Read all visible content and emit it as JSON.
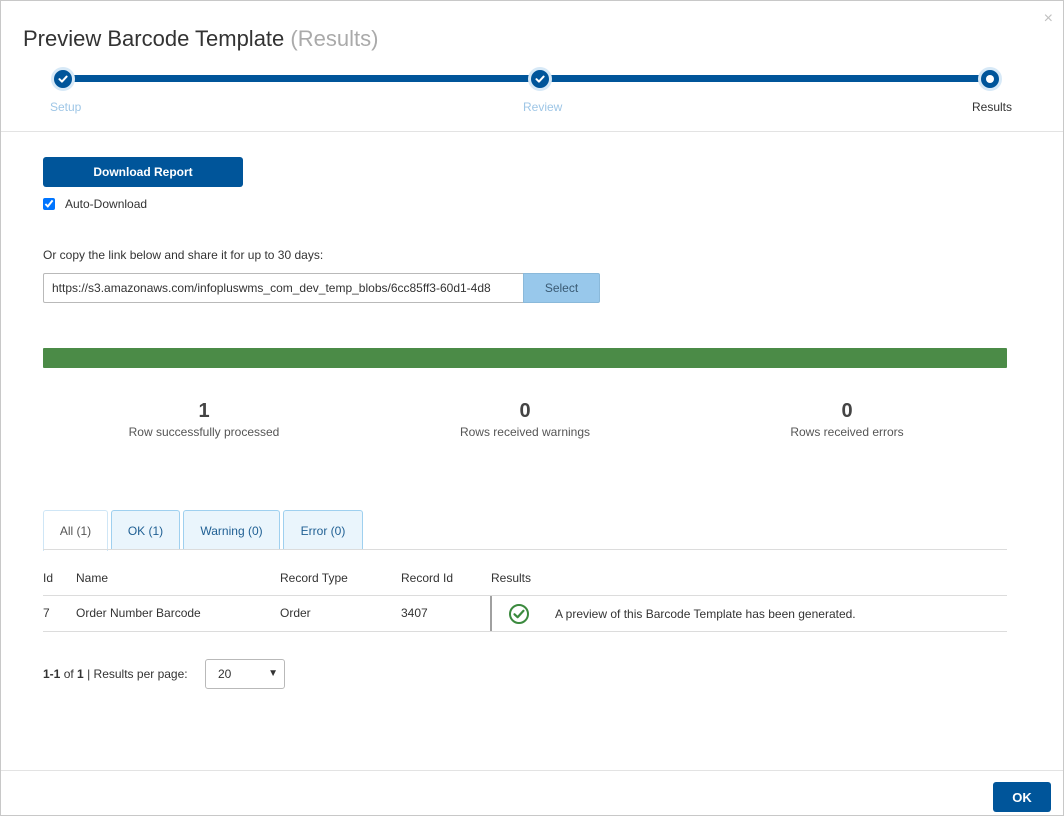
{
  "dialog": {
    "title": "Preview Barcode Template",
    "title_suffix": "(Results)",
    "close_symbol": "×"
  },
  "stepper": {
    "steps": [
      {
        "label": "Setup",
        "state": "complete"
      },
      {
        "label": "Review",
        "state": "complete"
      },
      {
        "label": "Results",
        "state": "current"
      }
    ]
  },
  "actions": {
    "download_label": "Download Report",
    "auto_download_label": "Auto-Download",
    "auto_download_checked": true
  },
  "share": {
    "instruction": "Or copy the link below and share it for up to 30 days:",
    "link_value": "https://s3.amazonaws.com/infopluswms_com_dev_temp_blobs/6cc85ff3-60d1-4d8",
    "select_label": "Select"
  },
  "progress": {
    "percent": 100,
    "color": "#4b8b47"
  },
  "stats": [
    {
      "value": "1",
      "label": "Row successfully processed"
    },
    {
      "value": "0",
      "label": "Rows received warnings"
    },
    {
      "value": "0",
      "label": "Rows received errors"
    }
  ],
  "tabs": [
    {
      "label": "All (1)",
      "active": true
    },
    {
      "label": "OK (1)",
      "active": false
    },
    {
      "label": "Warning (0)",
      "active": false
    },
    {
      "label": "Error (0)",
      "active": false
    }
  ],
  "table": {
    "columns": [
      "Id",
      "Name",
      "Record Type",
      "Record Id",
      "Results"
    ],
    "rows": [
      {
        "id": "7",
        "name": "Order Number Barcode",
        "record_type": "Order",
        "record_id": "3407",
        "result_icon": "check-circle-icon",
        "result_message": "A preview of this Barcode Template has been generated."
      }
    ]
  },
  "pagination": {
    "range": "1-1",
    "of_label": "of",
    "total": "1",
    "separator": "|",
    "per_page_label": "Results per page:",
    "per_page_value": "20"
  },
  "footer": {
    "ok_label": "OK"
  },
  "colors": {
    "brand": "#00559a",
    "success": "#3b8a3e",
    "tab_bg": "#eaf5fc"
  }
}
